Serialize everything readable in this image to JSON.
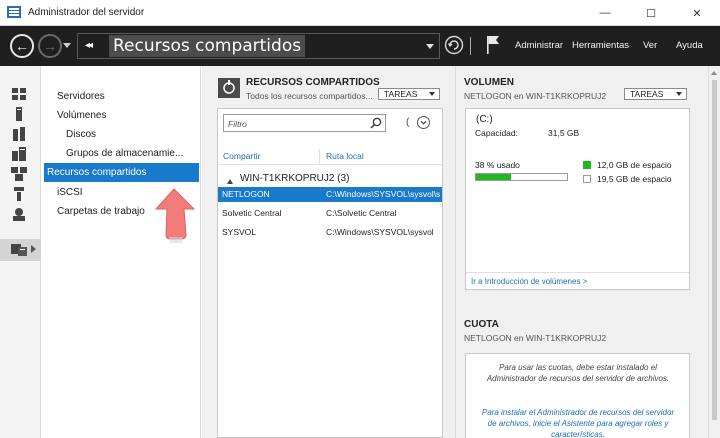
{
  "window": {
    "title": "Administrador del servidor",
    "minimize_glyph": "—",
    "maximize_glyph": "☐",
    "close_glyph": "✕"
  },
  "toolbar": {
    "back_glyph": "←",
    "forward_glyph": "→",
    "breadcrumb_chevron": "◂◂",
    "breadcrumb": "Recursos compartidos",
    "menu": [
      "Administrar",
      "Herramientas",
      "Ver",
      "Ayuda"
    ]
  },
  "rail_icons": [
    "dashboard-icon",
    "server-icon",
    "servers-group-icon",
    "volumes-icon",
    "file-services-icon",
    "storage-icon",
    "roles-icon",
    "file-storage-icon"
  ],
  "nav": {
    "items": [
      {
        "label": "Servidores",
        "sub": false,
        "selected": false
      },
      {
        "label": "Volúmenes",
        "sub": false,
        "selected": false
      },
      {
        "label": "Discos",
        "sub": true,
        "selected": false
      },
      {
        "label": "Grupos de almacenamie...",
        "sub": true,
        "selected": false
      },
      {
        "label": "Recursos compartidos",
        "sub": false,
        "selected": true
      },
      {
        "label": "iSCSI",
        "sub": false,
        "selected": false
      },
      {
        "label": "Carpetas de trabajo",
        "sub": false,
        "selected": false
      }
    ]
  },
  "shares": {
    "title": "RECURSOS COMPARTIDOS",
    "subtitle": "Todos los recursos compartidos...",
    "tasks": "TAREAS",
    "filter_placeholder": "Filtro",
    "paren_glyph": "(",
    "columns": [
      "Compartir",
      "Ruta local"
    ],
    "group": "WIN-T1KRKOPRUJ2 (3)",
    "rows": [
      {
        "share": "NETLOGON",
        "path": "C:\\Windows\\SYSVOL\\sysvol\\s",
        "selected": true
      },
      {
        "share": "Solvetic Central",
        "path": "C:\\Solvetic Central",
        "selected": false
      },
      {
        "share": "SYSVOL",
        "path": "C:\\Windows\\SYSVOL\\sysvol",
        "selected": false
      }
    ]
  },
  "volume": {
    "title": "VOLUMEN",
    "subtitle": "NETLOGON en WIN-T1KRKOPRUJ2",
    "tasks": "TAREAS",
    "drive": "(C:)",
    "capacity_label": "Capacidad:",
    "capacity_value": "31,5 GB",
    "used_label": "38 % usado",
    "used_fraction": 0.38,
    "free_space": "12,0 GB de espacio",
    "used_space": "19,5 GB de espacio",
    "free_color": "#22b722",
    "link": "Ir a Introducción de volúmenes >"
  },
  "quota": {
    "title": "CUOTA",
    "subtitle": "NETLOGON en WIN-T1KRKOPRUJ2",
    "message": "Para usar las cuotas, debe estar instalado el Administrador de recursos del servidor de archivos.",
    "link": "Para instalar el Administrador de recursos del servidor de archivos, inicie el Asistente para agregar roles y características."
  }
}
